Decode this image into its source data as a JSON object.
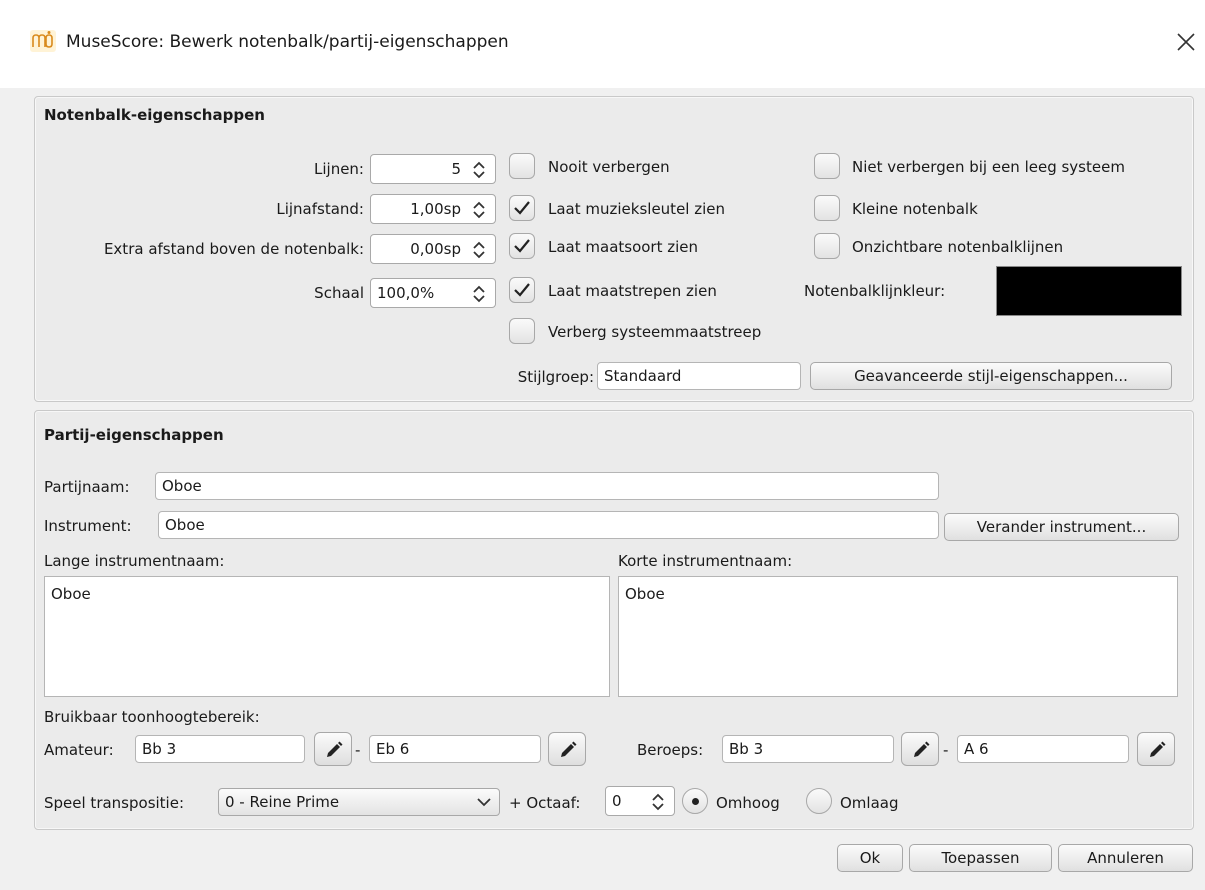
{
  "window": {
    "title": "MuseScore: Bewerk notenbalk/partij-eigenschappen"
  },
  "staff": {
    "title": "Notenbalk-eigenschappen",
    "lines_label": "Lijnen:",
    "lines_value": "5",
    "spacing_label": "Lijnafstand:",
    "spacing_value": "1,00sp",
    "extra_label": "Extra afstand boven de notenbalk:",
    "extra_value": "0,00sp",
    "scale_label": "Schaal",
    "scale_value": "100,0%",
    "never_hide": {
      "label": "Nooit verbergen",
      "checked": false
    },
    "show_clef": {
      "label": "Laat muzieksleutel zien",
      "checked": true
    },
    "show_timesig": {
      "label": "Laat maatsoort zien",
      "checked": true
    },
    "show_barlines": {
      "label": "Laat maatstrepen zien",
      "checked": true
    },
    "hide_system_barline": {
      "label": "Verberg systeemmaatstreep",
      "checked": false
    },
    "no_hide_empty": {
      "label": "Niet verbergen bij een leeg systeem",
      "checked": false
    },
    "small_staff": {
      "label": "Kleine notenbalk",
      "checked": false
    },
    "invisible_lines": {
      "label": "Onzichtbare notenbalklijnen",
      "checked": false
    },
    "line_color_label": "Notenbalklijnkleur:",
    "line_color": "#000000",
    "style_group_label": "Stijlgroep:",
    "style_group_value": "Standaard",
    "advanced_button": "Geavanceerde stijl-eigenschappen..."
  },
  "part": {
    "title": "Partij-eigenschappen",
    "partname_label": "Partijnaam:",
    "partname_value": "Oboe",
    "instrument_label": "Instrument:",
    "instrument_value": "Oboe",
    "change_instrument_button": "Verander instrument...",
    "long_name_label": "Lange instrumentnaam:",
    "long_name_value": "Oboe",
    "short_name_label": "Korte instrumentnaam:",
    "short_name_value": "Oboe",
    "range_label": "Bruikbaar toonhoogtebereik:",
    "amateur_label": "Amateur:",
    "amateur_low": "Bb 3",
    "amateur_high": "Eb 6",
    "pro_label": "Beroeps:",
    "pro_low": "Bb 3",
    "pro_high": "A 6",
    "dash": "-",
    "transpose_label": "Speel transpositie:",
    "transpose_value": "0 - Reine Prime",
    "octave_label": "+ Octaaf:",
    "octave_value": "0",
    "up_label": "Omhoog",
    "down_label": "Omlaag",
    "direction": "up"
  },
  "buttons": {
    "ok": "Ok",
    "apply": "Toepassen",
    "cancel": "Annuleren"
  }
}
